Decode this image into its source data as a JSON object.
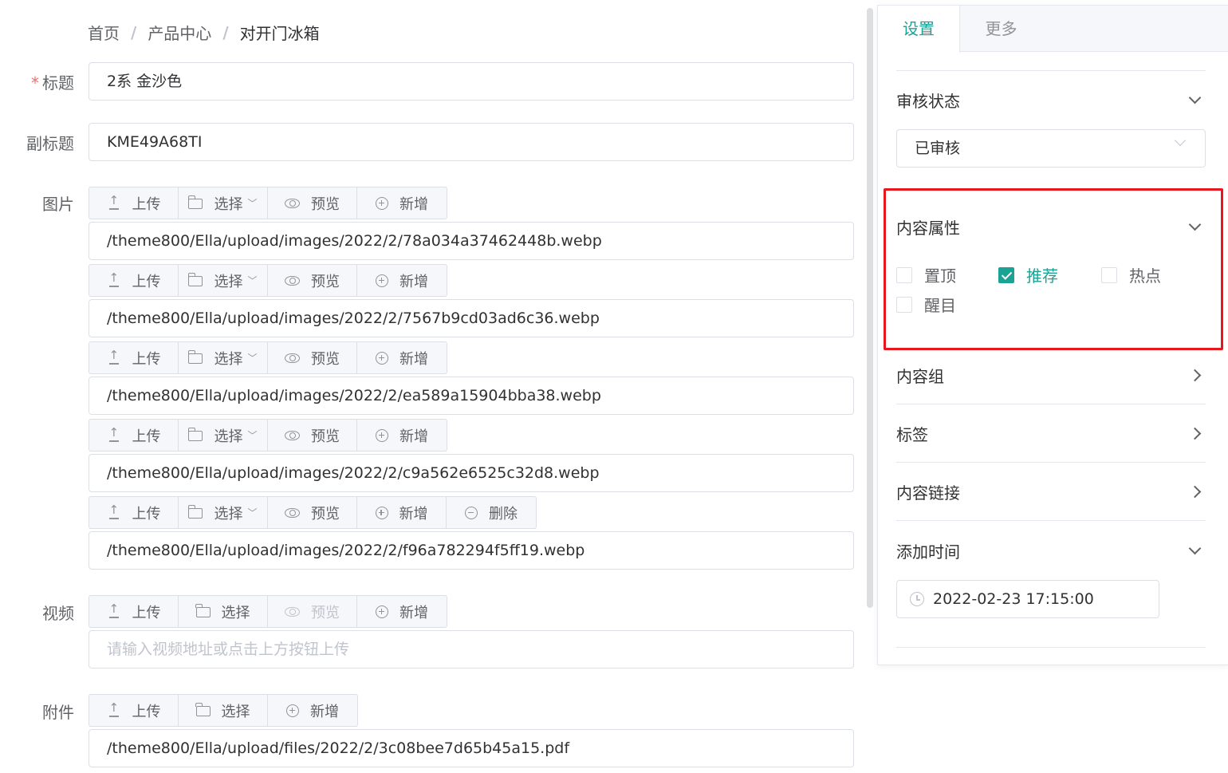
{
  "breadcrumb": [
    "首页",
    "产品中心",
    "对开门冰箱"
  ],
  "breadcrumb_separator": "/",
  "form": {
    "title_label": "标题",
    "title_required_mark": "*",
    "title_value": "2系 金沙色",
    "subtitle_label": "副标题",
    "subtitle_value": "KME49A68TI",
    "images_label": "图片",
    "video_label": "视频",
    "video_placeholder": "请输入视频地址或点击上方按钮上传",
    "attachment_label": "附件",
    "attachment_value": "/theme800/Ella/upload/files/2022/2/3c08bee7d65b45a15.pdf"
  },
  "buttons": {
    "upload": "上传",
    "select": "选择",
    "preview": "预览",
    "add": "新增",
    "delete": "删除"
  },
  "images": [
    "/theme800/Ella/upload/images/2022/2/78a034a37462448b.webp",
    "/theme800/Ella/upload/images/2022/2/7567b9cd03ad6c36.webp",
    "/theme800/Ella/upload/images/2022/2/ea589a15904bba38.webp",
    "/theme800/Ella/upload/images/2022/2/c9a562e6525c32d8.webp",
    "/theme800/Ella/upload/images/2022/2/f96a782294f5ff19.webp"
  ],
  "panel": {
    "tabs": [
      "设置",
      "更多"
    ],
    "active_tab": "设置",
    "review_status_title": "审核状态",
    "review_status_value": "已审核",
    "content_attr_title": "内容属性",
    "attrs": [
      {
        "label": "置顶",
        "checked": false
      },
      {
        "label": "推荐",
        "checked": true
      },
      {
        "label": "热点",
        "checked": false
      },
      {
        "label": "醒目",
        "checked": false
      }
    ],
    "content_group_title": "内容组",
    "tags_title": "标签",
    "content_link_title": "内容链接",
    "add_time_title": "添加时间",
    "add_time_value": "2022-02-23 17:15:00"
  },
  "colors": {
    "accent": "#1aa394",
    "highlight": "#e8161d",
    "required": "#f56c6c"
  }
}
